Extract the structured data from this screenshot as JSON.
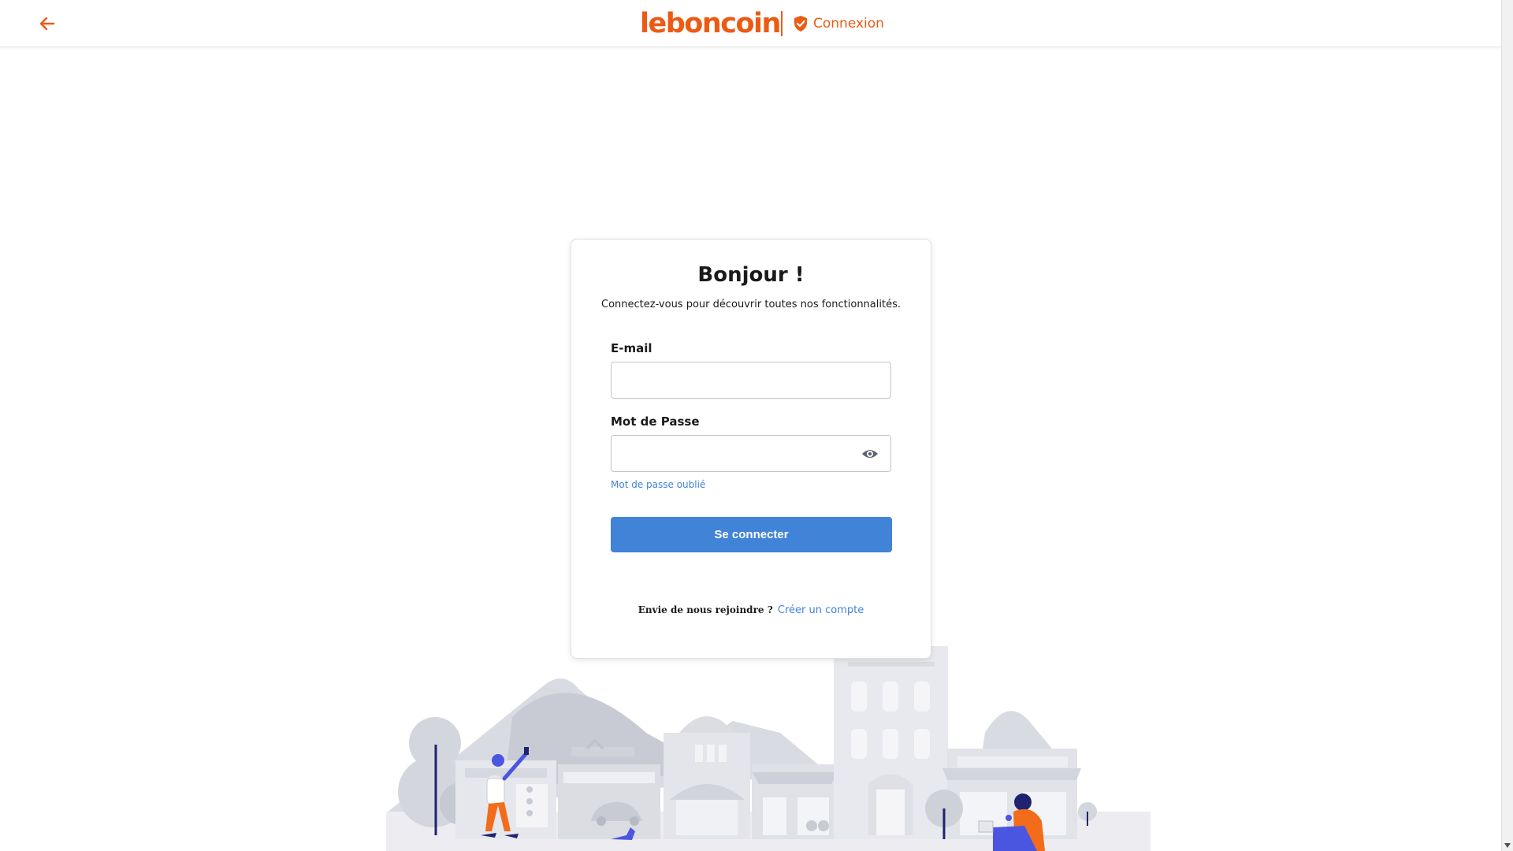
{
  "header": {
    "logo_text": "leboncoin",
    "secure_label": "Connexion",
    "back_icon": "arrow-left-icon",
    "secure_icon": "shield-check-icon"
  },
  "card": {
    "title": "Bonjour !",
    "subtitle": "Connectez-vous pour découvrir toutes nos fonctionnalités.",
    "email": {
      "label": "E-mail",
      "value": "",
      "placeholder": ""
    },
    "password": {
      "label": "Mot de Passe",
      "value": "",
      "placeholder": "",
      "toggle_icon": "eye-icon"
    },
    "forgot_label": "Mot de passe oublié",
    "submit_label": "Se connecter",
    "join_text": "Envie de nous rejoindre ?",
    "create_account_label": "Créer un compte"
  },
  "colors": {
    "brand": "#ec5a13",
    "primary": "#4183d7",
    "illustration_accent": "#4a55e0"
  }
}
